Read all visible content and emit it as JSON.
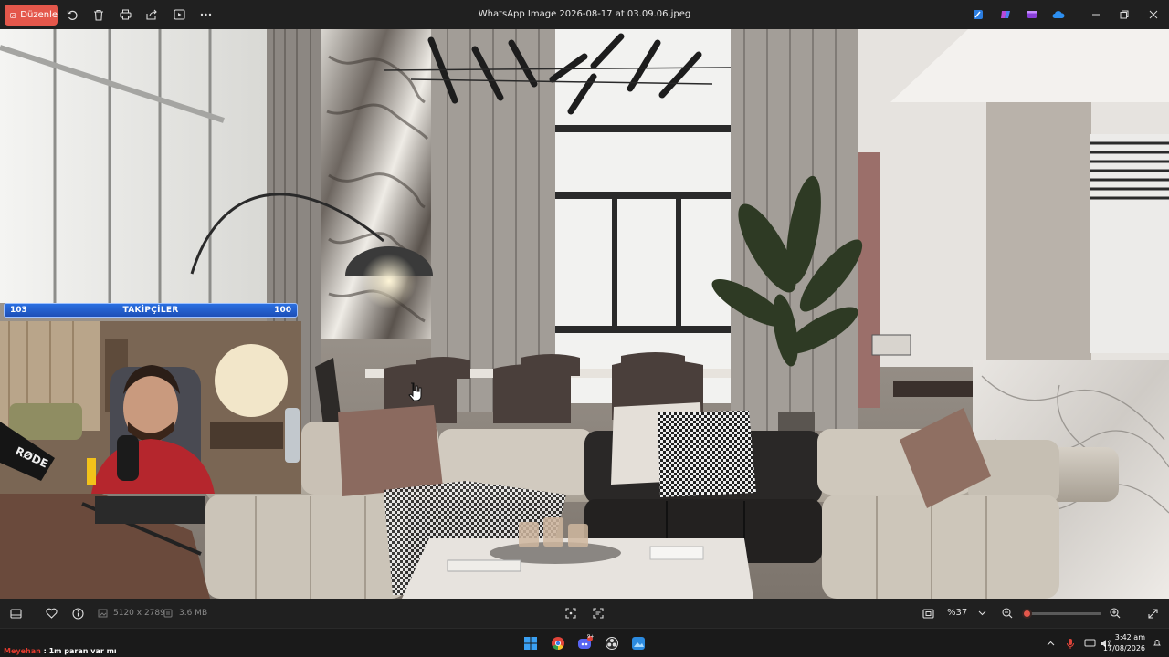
{
  "toolbar": {
    "edit_label": "Düzenle",
    "title": "WhatsApp Image 2026-08-17 at 03.09.06.jpeg"
  },
  "overlay": {
    "followers_label": "TAKİPÇİLER",
    "followers_current": "103",
    "followers_goal": "100"
  },
  "statusbar": {
    "dimensions": "5120 x 2789",
    "file_size": "3.6 MB",
    "zoom": "%37",
    "zoom_fraction": 0.05
  },
  "taskbar": {
    "chat_user": "Meyehan",
    "chat_message": ": 1m paran var mı",
    "time": "3:42 am",
    "date": "17/08/2026",
    "discord_badge": "9+"
  },
  "colors": {
    "accent": "#e4574b",
    "followers_bar": "#2b6fe0",
    "bar_bg": "#202020"
  }
}
